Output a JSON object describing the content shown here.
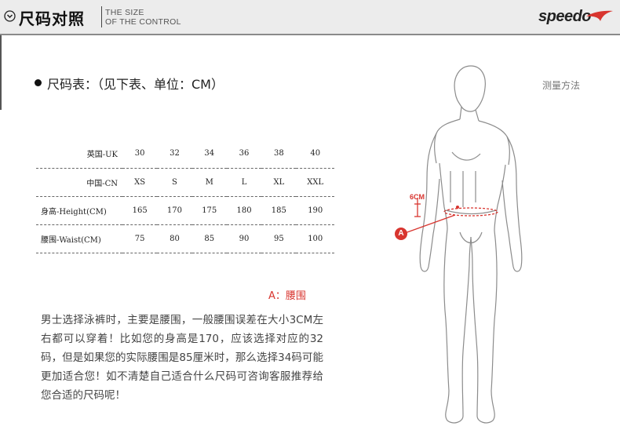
{
  "header": {
    "title_cn": "尺码对照",
    "title_en_line1": "THE SIZE",
    "title_en_line2": "OF THE CONTROL",
    "brand": "speedo",
    "accent_color": "#d8352f"
  },
  "section": {
    "title": "尺码表：（见下表、单位：CM）",
    "measure_method": "测量方法"
  },
  "size_table": {
    "rows": [
      {
        "label": "英国-UK",
        "values": [
          "30",
          "32",
          "34",
          "36",
          "38",
          "40"
        ]
      },
      {
        "label": "中国-CN",
        "values": [
          "XS",
          "S",
          "M",
          "L",
          "XL",
          "XXL"
        ]
      },
      {
        "label": "身高-Height(CM)",
        "values": [
          "165",
          "170",
          "175",
          "180",
          "185",
          "190"
        ]
      },
      {
        "label": "腰围-Waist(CM)",
        "values": [
          "75",
          "80",
          "85",
          "90",
          "95",
          "100"
        ]
      }
    ]
  },
  "figure": {
    "cm_label": "6CM",
    "marker": "A"
  },
  "legend": {
    "a_label": "A：腰围"
  },
  "description": "男士选择泳裤时，主要是腰围，一般腰围误差在大小3CM左右都可以穿着！比如您的身高是170，应该选择对应的32码，但是如果您的实际腰围是85厘米时，那么选择34码可能更加适合您！如不清楚自己适合什么尺码可咨询客服推荐给您合适的尺码呢！"
}
